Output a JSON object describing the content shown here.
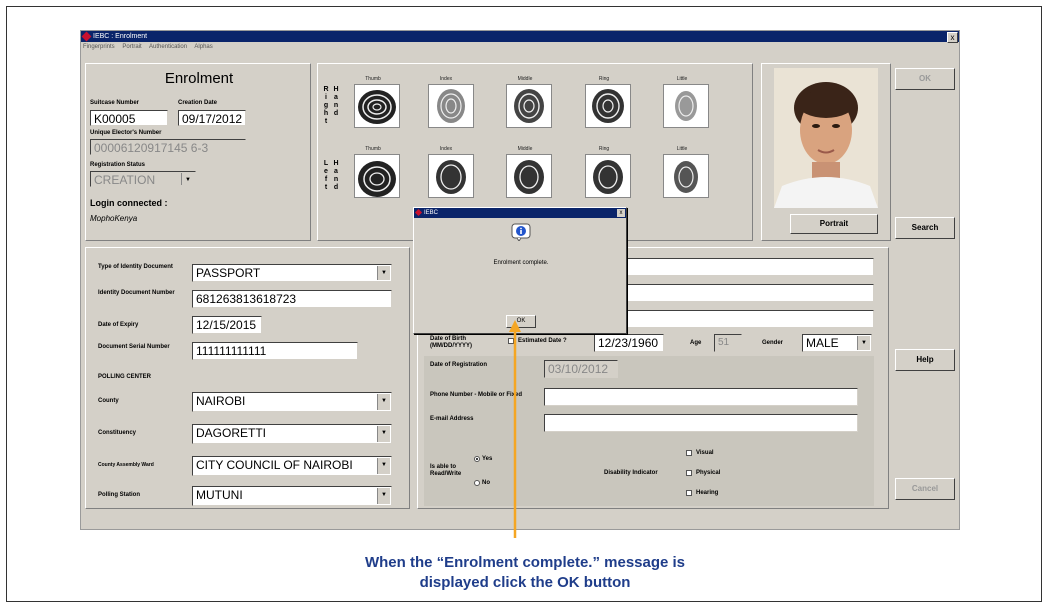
{
  "window": {
    "title": "IEBC : Enrolment",
    "close": "x"
  },
  "menu": [
    "Fingerprints",
    "Portrait",
    "Authentication",
    "Alphas"
  ],
  "enrolment": {
    "heading": "Enrolment",
    "suitcase_label": "Suitcase Number",
    "suitcase_value": "K00005",
    "creation_label": "Creation Date",
    "creation_value": "09/17/2012",
    "unique_label": "Unique Elector's Number",
    "unique_value": "00006120917145 6-3",
    "reg_status_label": "Registration Status",
    "reg_status_value": "CREATION",
    "login_label": "Login connected :",
    "login_value": "MophoKenya"
  },
  "fingerprints": {
    "right_hand": "Right",
    "left_hand": "Left",
    "hand_word": "Hand",
    "fingers": [
      "Thumb",
      "Index",
      "Middle",
      "Ring",
      "Little"
    ]
  },
  "portrait": {
    "button": "Portrait"
  },
  "side_buttons": {
    "ok": "OK",
    "search": "Search",
    "help": "Help",
    "cancel": "Cancel"
  },
  "identity": {
    "type_label": "Type of Identity Document",
    "type_value": "PASSPORT",
    "doc_number_label": "Identity Document Number",
    "doc_number_value": "681263813618723",
    "expiry_label": "Date of Expiry",
    "expiry_value": "12/15/2015",
    "serial_label": "Document Serial Number",
    "serial_value": "111111111111"
  },
  "polling": {
    "heading": "POLLING CENTER",
    "county_label": "County",
    "county_value": "NAIROBI",
    "constituency_label": "Constituency",
    "constituency_value": "DAGORETTI",
    "ward_label": "County Assembly Ward",
    "ward_value": "CITY COUNCIL OF NAIROBI",
    "station_label": "Polling Station",
    "station_value": "MUTUNI"
  },
  "personal": {
    "dob_label": "Date of Birth (MM/DD/YYYY)",
    "estimated_label": "Estimated Date ?",
    "dob_value": "12/23/1960",
    "age_label": "Age",
    "age_value": "51",
    "gender_label": "Gender",
    "gender_value": "MALE",
    "reg_date_label": "Date of Registration",
    "reg_date_value": "03/10/2012",
    "phone_label": "Phone Number - Mobile or Fixed",
    "email_label": "E-mail Address",
    "read_label": "Is able to Read/Write",
    "yes_label": "Yes",
    "no_label": "No",
    "disability_label": "Disability Indicator",
    "visual_label": "Visual",
    "physical_label": "Physical",
    "hearing_label": "Hearing"
  },
  "dialog": {
    "title": "IEBC",
    "message": "Enrolment complete.",
    "ok": "OK",
    "close": "x"
  },
  "caption": {
    "line1": "When the “Enrolment complete.” message is",
    "line2": "displayed click the OK button"
  },
  "colors": {
    "titlebar": "#0a246a",
    "window_bg": "#d4d0c8",
    "arrow": "#f5a623",
    "caption": "#1f3d8a",
    "brand": "#c8102e"
  }
}
